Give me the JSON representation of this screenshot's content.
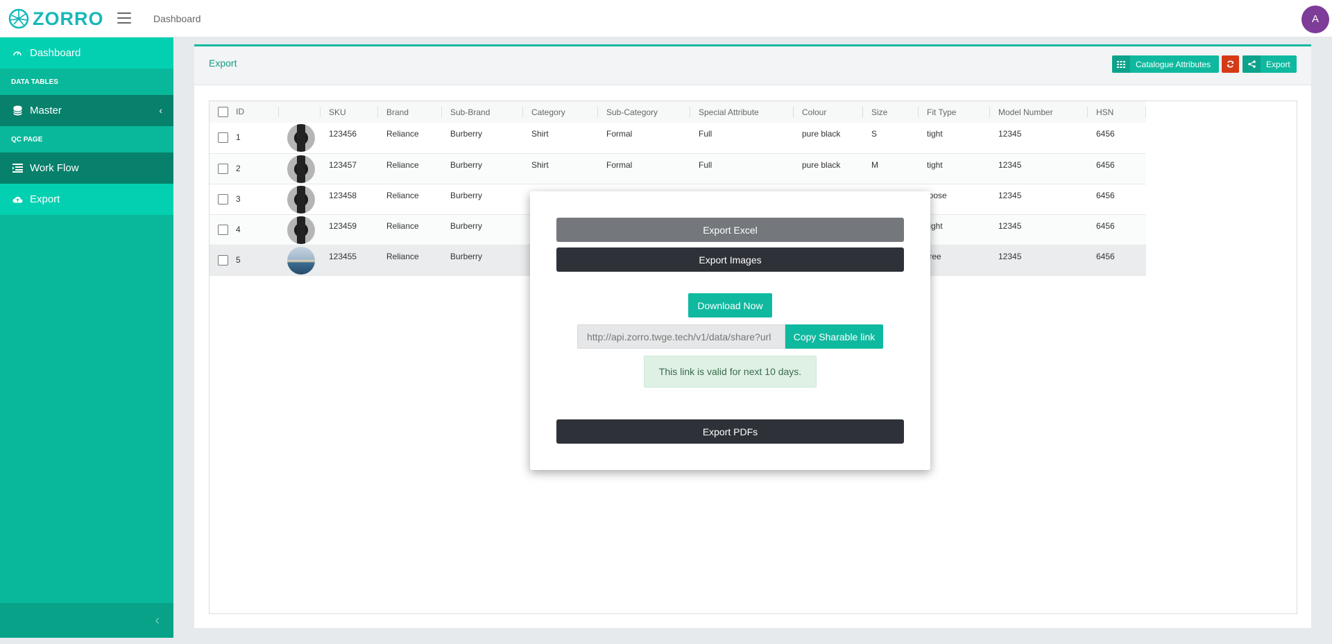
{
  "header": {
    "brand": "ZORRO",
    "breadcrumb": "Dashboard",
    "avatar_initial": "A"
  },
  "sidebar": {
    "items": [
      {
        "label": "Dashboard",
        "icon": "gauge-icon"
      },
      {
        "label": "Master",
        "icon": "database-icon"
      },
      {
        "label": "Work Flow",
        "icon": "list-icon"
      },
      {
        "label": "Export",
        "icon": "cloud-upload-icon"
      }
    ],
    "headers": [
      "DATA TABLES",
      "QC PAGE"
    ]
  },
  "panel": {
    "title": "Export",
    "buttons": {
      "catalogue_attributes": "Catalogue Attributes",
      "export": "Export"
    }
  },
  "table": {
    "columns": [
      "ID",
      "",
      "SKU",
      "Brand",
      "Sub-Brand",
      "Category",
      "Sub-Category",
      "Special Attribute",
      "Colour",
      "Size",
      "Fit Type",
      "Model Number",
      "HSN"
    ],
    "rows": [
      {
        "id": "1",
        "sku": "123456",
        "brand": "Reliance",
        "sub_brand": "Burberry",
        "category": "Shirt",
        "sub_category": "Formal",
        "special_attribute": "Full",
        "colour": "pure black",
        "size": "S",
        "fit_type": "tight",
        "model_number": "12345",
        "hsn": "6456"
      },
      {
        "id": "2",
        "sku": "123457",
        "brand": "Reliance",
        "sub_brand": "Burberry",
        "category": "Shirt",
        "sub_category": "Formal",
        "special_attribute": "Full",
        "colour": "pure black",
        "size": "M",
        "fit_type": "tight",
        "model_number": "12345",
        "hsn": "6456"
      },
      {
        "id": "3",
        "sku": "123458",
        "brand": "Reliance",
        "sub_brand": "Burberry",
        "category": "",
        "sub_category": "",
        "special_attribute": "",
        "colour": "",
        "size": "",
        "fit_type": "loose",
        "model_number": "12345",
        "hsn": "6456"
      },
      {
        "id": "4",
        "sku": "123459",
        "brand": "Reliance",
        "sub_brand": "Burberry",
        "category": "",
        "sub_category": "",
        "special_attribute": "",
        "colour": "",
        "size": "",
        "fit_type": "tight",
        "model_number": "12345",
        "hsn": "6456"
      },
      {
        "id": "5",
        "sku": "123455",
        "brand": "Reliance",
        "sub_brand": "Burberry",
        "category": "",
        "sub_category": "",
        "special_attribute": "",
        "colour": "",
        "size": "",
        "fit_type": "free",
        "model_number": "12345",
        "hsn": "6456"
      }
    ]
  },
  "modal": {
    "export_excel": "Export Excel",
    "export_images": "Export Images",
    "download_now": "Download Now",
    "share_url": "http://api.zorro.twge.tech/v1/data/share?url",
    "copy_link": "Copy Sharable link",
    "valid_note": "This link is valid for next 10 days.",
    "export_pdfs": "Export PDFs"
  }
}
